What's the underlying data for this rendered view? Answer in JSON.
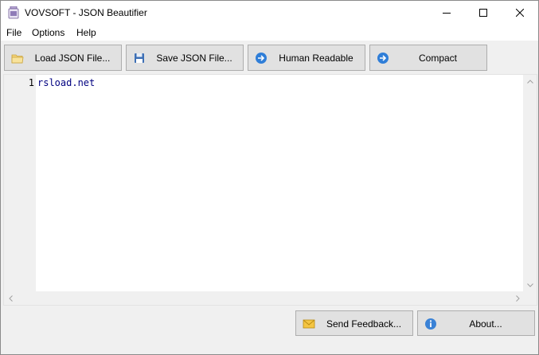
{
  "window": {
    "title": "VOVSOFT - JSON Beautifier"
  },
  "menu": {
    "items": [
      "File",
      "Options",
      "Help"
    ]
  },
  "toolbar": {
    "load_label": "Load JSON File...",
    "save_label": "Save JSON File...",
    "human_readable_label": "Human Readable",
    "compact_label": "Compact"
  },
  "editor": {
    "lines": [
      {
        "number": "1",
        "text": "rsload.net"
      }
    ]
  },
  "footer": {
    "feedback_label": "Send Feedback...",
    "about_label": "About..."
  },
  "icons": {
    "app": "jar-app-icon",
    "load": "folder-icon",
    "save": "floppy-disk-icon",
    "human_readable": "arrow-right-circle-icon",
    "compact": "arrow-right-circle-icon",
    "feedback": "envelope-icon",
    "about": "info-icon"
  },
  "colors": {
    "code_text": "#000080",
    "accent_blue": "#2f7ed8"
  }
}
